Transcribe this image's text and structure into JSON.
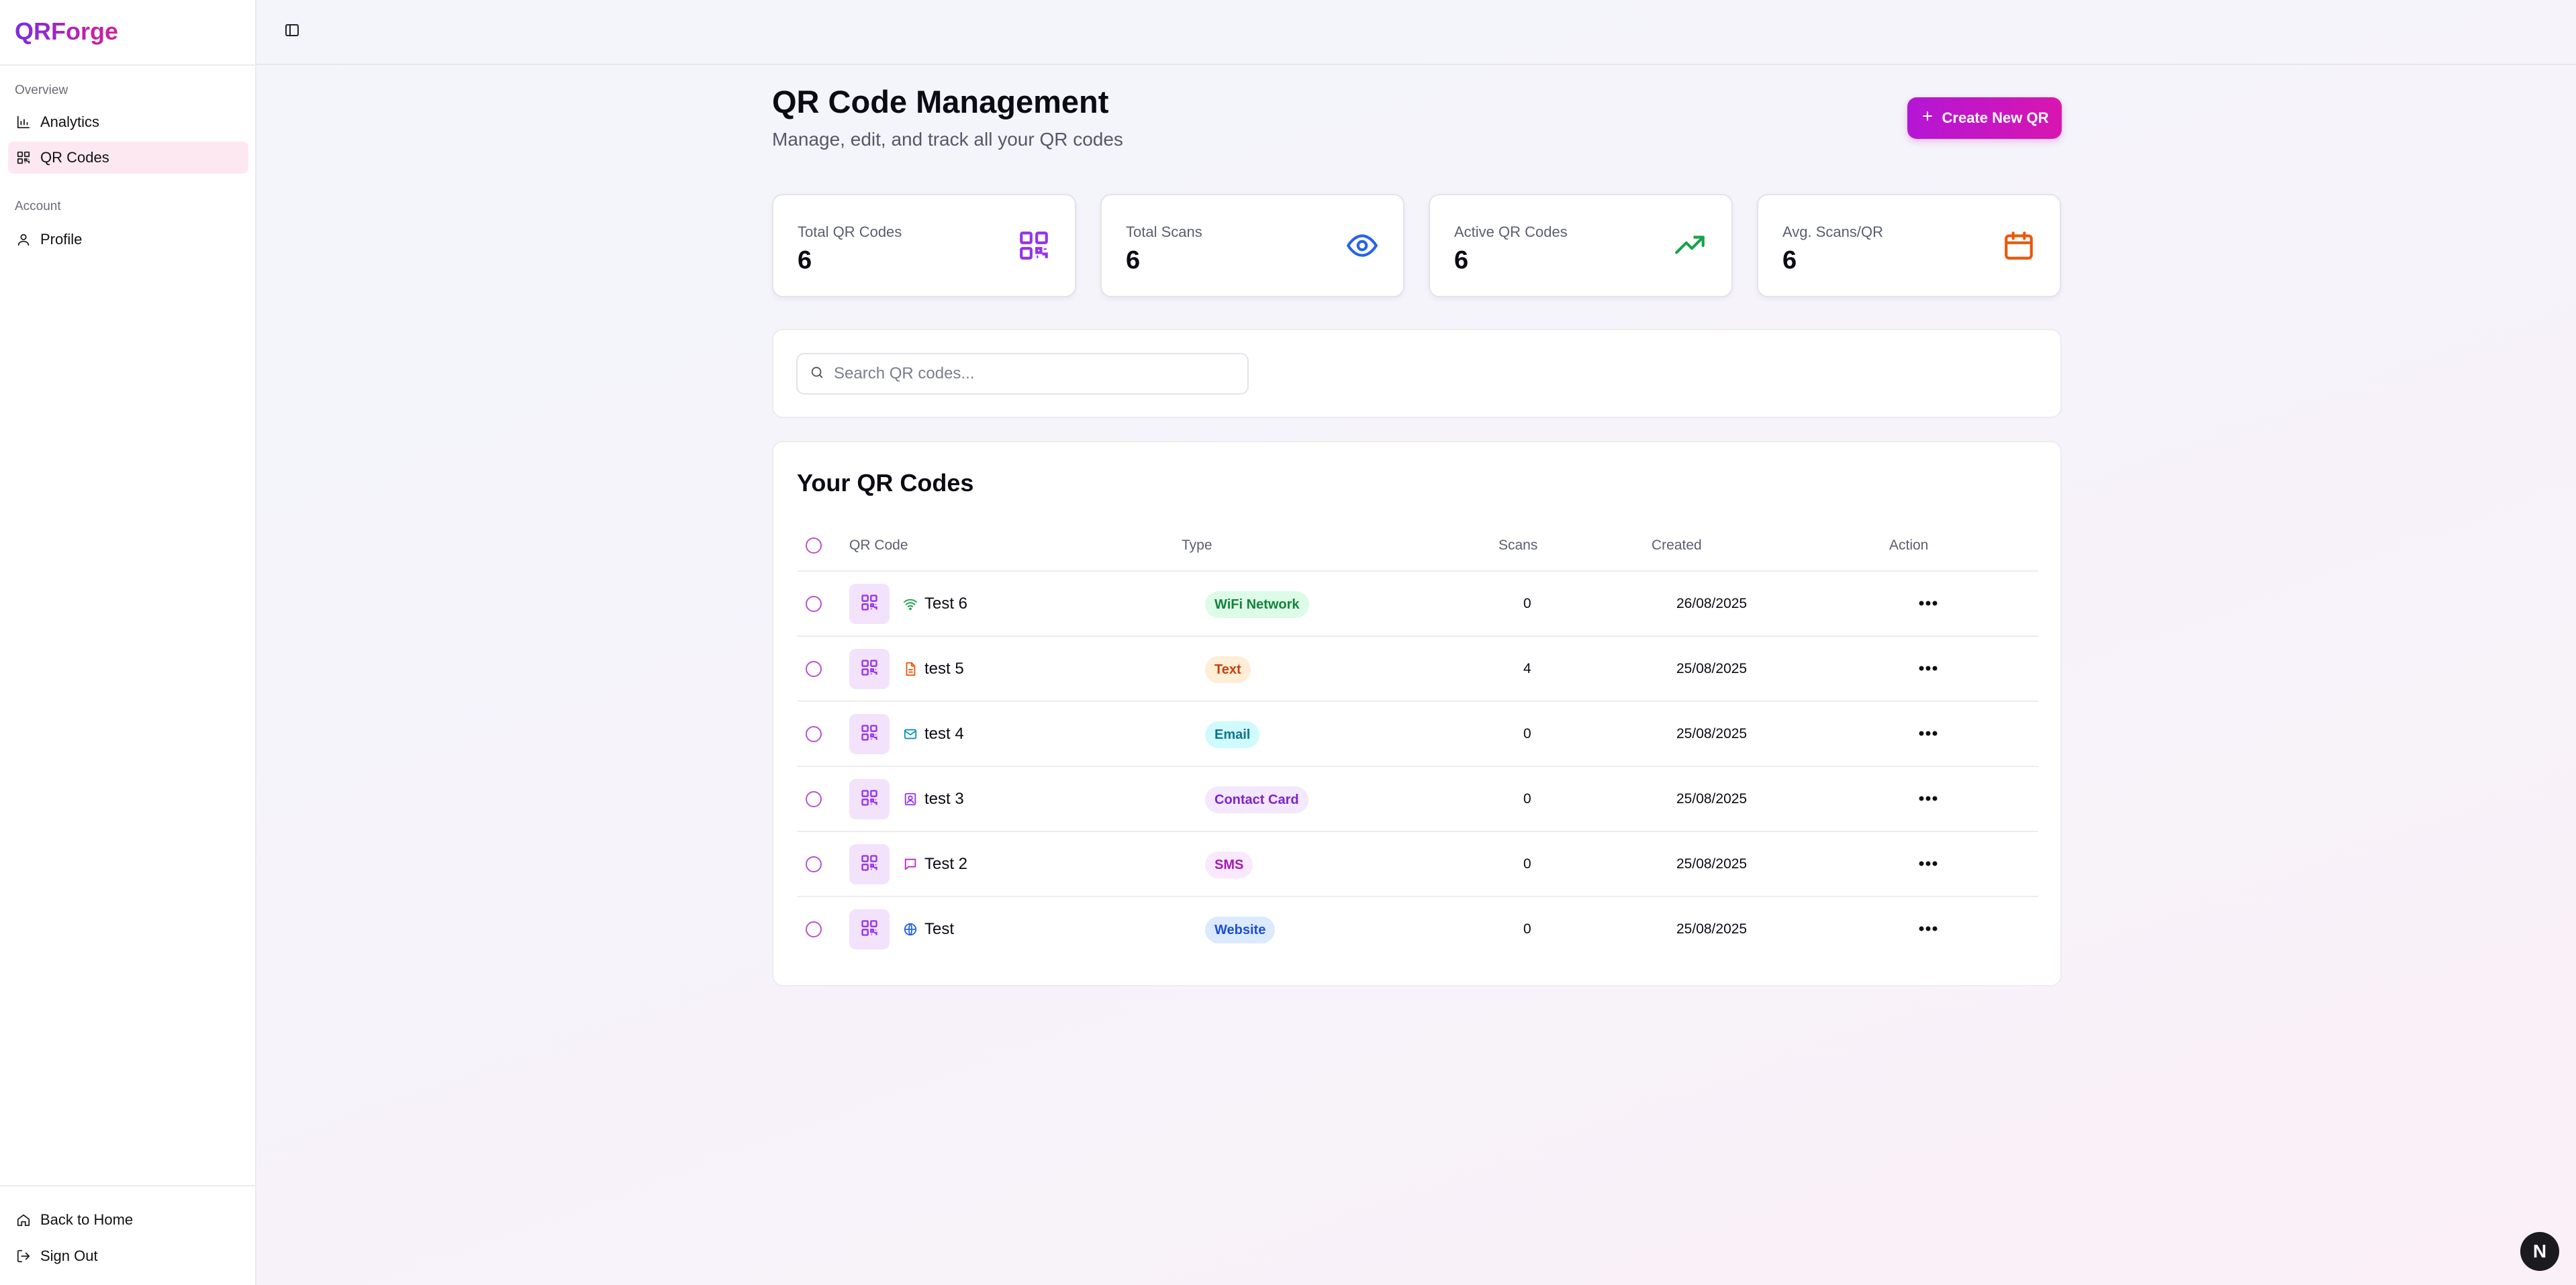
{
  "brand": {
    "name": "QRForge"
  },
  "sidebar": {
    "groups": [
      {
        "label": "Overview"
      },
      {
        "label": "Account"
      }
    ],
    "items": [
      {
        "label": "Analytics",
        "icon": "bar-chart-icon"
      },
      {
        "label": "QR Codes",
        "icon": "qr-code-icon",
        "active": true
      },
      {
        "label": "Profile",
        "icon": "user-icon"
      }
    ],
    "footer": [
      {
        "label": "Back to Home",
        "icon": "home-icon"
      },
      {
        "label": "Sign Out",
        "icon": "sign-out-icon"
      }
    ]
  },
  "header": {
    "title": "QR Code Management",
    "subtitle": "Manage, edit, and track all your QR codes",
    "create_label": "Create New QR"
  },
  "stats": [
    {
      "label": "Total QR Codes",
      "value": "6",
      "icon": "qr-code-icon",
      "color": "#9333ea"
    },
    {
      "label": "Total Scans",
      "value": "6",
      "icon": "eye-icon",
      "color": "#2563eb"
    },
    {
      "label": "Active QR Codes",
      "value": "6",
      "icon": "trending-up-icon",
      "color": "#16a34a"
    },
    {
      "label": "Avg. Scans/QR",
      "value": "6",
      "icon": "calendar-icon",
      "color": "#ea580c"
    }
  ],
  "search": {
    "placeholder": "Search QR codes..."
  },
  "table": {
    "title": "Your QR Codes",
    "columns": [
      "QR Code",
      "Type",
      "Scans",
      "Created",
      "Action"
    ],
    "rows": [
      {
        "name": "Test 6",
        "type": "WiFi Network",
        "type_icon": "wifi-icon",
        "scans": "0",
        "created": "26/08/2025",
        "badge_bg": "#dcfce7",
        "badge_fg": "#15803d",
        "icon_color": "#16a34a"
      },
      {
        "name": "test 5",
        "type": "Text",
        "type_icon": "document-icon",
        "scans": "4",
        "created": "25/08/2025",
        "badge_bg": "#ffedd5",
        "badge_fg": "#c2410c",
        "icon_color": "#ea580c"
      },
      {
        "name": "test 4",
        "type": "Email",
        "type_icon": "mail-icon",
        "scans": "0",
        "created": "25/08/2025",
        "badge_bg": "#cffafe",
        "badge_fg": "#0e7490",
        "icon_color": "#0891b2"
      },
      {
        "name": "test 3",
        "type": "Contact Card",
        "type_icon": "contact-card-icon",
        "scans": "0",
        "created": "25/08/2025",
        "badge_bg": "#f3e8ff",
        "badge_fg": "#7e22ce",
        "icon_color": "#9333ea"
      },
      {
        "name": "Test 2",
        "type": "SMS",
        "type_icon": "message-icon",
        "scans": "0",
        "created": "25/08/2025",
        "badge_bg": "#fae8ff",
        "badge_fg": "#a21caf",
        "icon_color": "#c026d3"
      },
      {
        "name": "Test",
        "type": "Website",
        "type_icon": "globe-icon",
        "scans": "0",
        "created": "25/08/2025",
        "badge_bg": "#dbeafe",
        "badge_fg": "#1d4ed8",
        "icon_color": "#2563eb"
      }
    ]
  },
  "floating": {
    "label": "N"
  }
}
